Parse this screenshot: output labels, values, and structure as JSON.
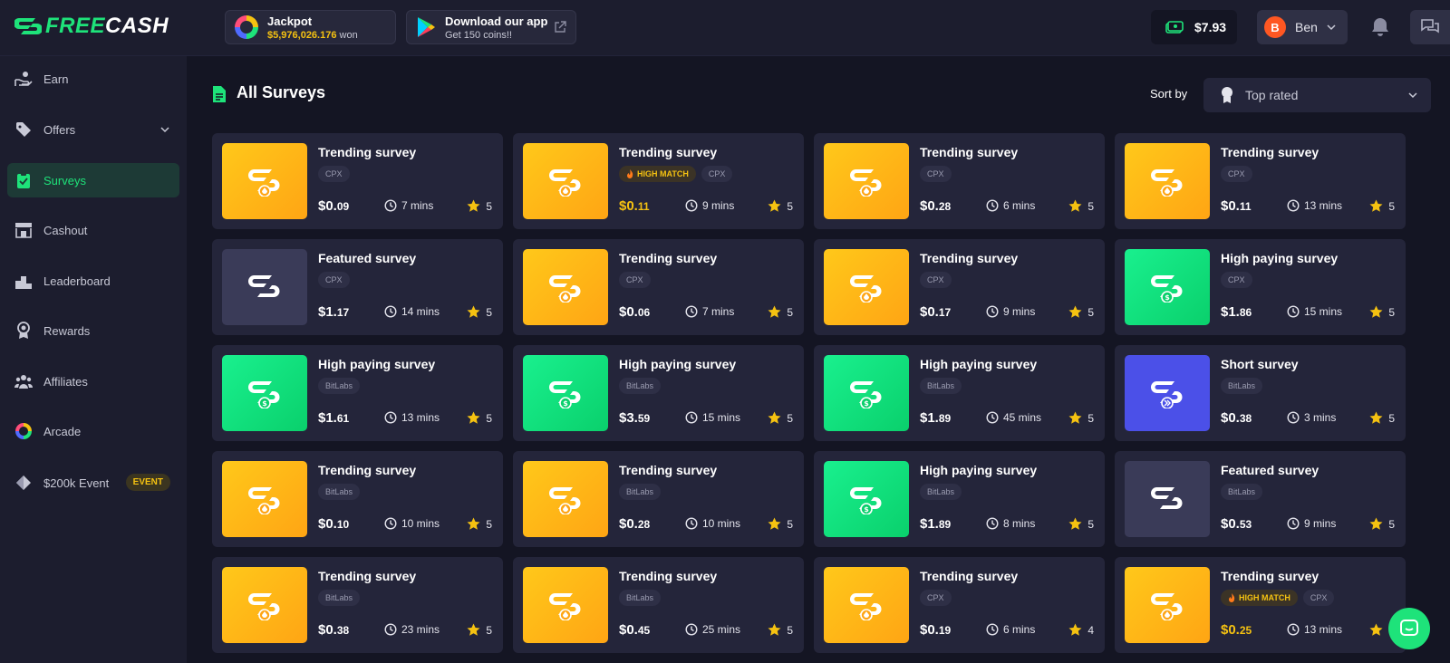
{
  "header": {
    "logo_text": "FREECASH",
    "jackpot": {
      "title": "Jackpot",
      "amount": "$5,976,026.176",
      "suffix": "won"
    },
    "download": {
      "title": "Download our app",
      "subtitle": "Get 150 coins!!"
    },
    "balance": "$7.93",
    "user": {
      "initial": "B",
      "name": "Ben"
    }
  },
  "sidebar": {
    "items": [
      {
        "label": "Earn",
        "icon": "hand-coin-icon"
      },
      {
        "label": "Offers",
        "icon": "tag-icon"
      },
      {
        "label": "Surveys",
        "icon": "clipboard-icon"
      },
      {
        "label": "Cashout",
        "icon": "store-icon"
      },
      {
        "label": "Leaderboard",
        "icon": "podium-icon"
      },
      {
        "label": "Rewards",
        "icon": "medal-icon"
      },
      {
        "label": "Affiliates",
        "icon": "users-icon"
      },
      {
        "label": "Arcade",
        "icon": "ring-icon"
      },
      {
        "label": "$200k Event",
        "icon": "diamond-icon",
        "badge": "EVENT"
      }
    ]
  },
  "main": {
    "title": "All Surveys",
    "sort_label": "Sort by",
    "sort_value": "Top rated",
    "surveys": [
      {
        "title": "Trending survey",
        "provider": "CPX",
        "high_match": false,
        "dollars": "$0.",
        "cents": "09",
        "time": "7 mins",
        "rating": "5",
        "style": "orange"
      },
      {
        "title": "Trending survey",
        "provider": "CPX",
        "high_match": true,
        "dollars": "$0.",
        "cents": "11",
        "time": "9 mins",
        "rating": "5",
        "style": "orange"
      },
      {
        "title": "Trending survey",
        "provider": "CPX",
        "high_match": false,
        "dollars": "$0.",
        "cents": "28",
        "time": "6 mins",
        "rating": "5",
        "style": "orange"
      },
      {
        "title": "Trending survey",
        "provider": "CPX",
        "high_match": false,
        "dollars": "$0.",
        "cents": "11",
        "time": "13 mins",
        "rating": "5",
        "style": "orange"
      },
      {
        "title": "Featured survey",
        "provider": "CPX",
        "high_match": false,
        "dollars": "$1.",
        "cents": "17",
        "time": "14 mins",
        "rating": "5",
        "style": "slate"
      },
      {
        "title": "Trending survey",
        "provider": "CPX",
        "high_match": false,
        "dollars": "$0.",
        "cents": "06",
        "time": "7 mins",
        "rating": "5",
        "style": "orange"
      },
      {
        "title": "Trending survey",
        "provider": "CPX",
        "high_match": false,
        "dollars": "$0.",
        "cents": "17",
        "time": "9 mins",
        "rating": "5",
        "style": "orange"
      },
      {
        "title": "High paying survey",
        "provider": "CPX",
        "high_match": false,
        "dollars": "$1.",
        "cents": "86",
        "time": "15 mins",
        "rating": "5",
        "style": "green"
      },
      {
        "title": "High paying survey",
        "provider": "BitLabs",
        "high_match": false,
        "dollars": "$1.",
        "cents": "61",
        "time": "13 mins",
        "rating": "5",
        "style": "green"
      },
      {
        "title": "High paying survey",
        "provider": "BitLabs",
        "high_match": false,
        "dollars": "$3.",
        "cents": "59",
        "time": "15 mins",
        "rating": "5",
        "style": "green"
      },
      {
        "title": "High paying survey",
        "provider": "BitLabs",
        "high_match": false,
        "dollars": "$1.",
        "cents": "89",
        "time": "45 mins",
        "rating": "5",
        "style": "green"
      },
      {
        "title": "Short survey",
        "provider": "BitLabs",
        "high_match": false,
        "dollars": "$0.",
        "cents": "38",
        "time": "3 mins",
        "rating": "5",
        "style": "purple"
      },
      {
        "title": "Trending survey",
        "provider": "BitLabs",
        "high_match": false,
        "dollars": "$0.",
        "cents": "10",
        "time": "10 mins",
        "rating": "5",
        "style": "orange"
      },
      {
        "title": "Trending survey",
        "provider": "BitLabs",
        "high_match": false,
        "dollars": "$0.",
        "cents": "28",
        "time": "10 mins",
        "rating": "5",
        "style": "orange"
      },
      {
        "title": "High paying survey",
        "provider": "BitLabs",
        "high_match": false,
        "dollars": "$1.",
        "cents": "89",
        "time": "8 mins",
        "rating": "5",
        "style": "green"
      },
      {
        "title": "Featured survey",
        "provider": "BitLabs",
        "high_match": false,
        "dollars": "$0.",
        "cents": "53",
        "time": "9 mins",
        "rating": "5",
        "style": "slate"
      },
      {
        "title": "Trending survey",
        "provider": "BitLabs",
        "high_match": false,
        "dollars": "$0.",
        "cents": "38",
        "time": "23 mins",
        "rating": "5",
        "style": "orange"
      },
      {
        "title": "Trending survey",
        "provider": "BitLabs",
        "high_match": false,
        "dollars": "$0.",
        "cents": "45",
        "time": "25 mins",
        "rating": "5",
        "style": "orange"
      },
      {
        "title": "Trending survey",
        "provider": "CPX",
        "high_match": false,
        "dollars": "$0.",
        "cents": "19",
        "time": "6 mins",
        "rating": "4",
        "style": "orange"
      },
      {
        "title": "Trending survey",
        "provider": "CPX",
        "high_match": true,
        "dollars": "$0.",
        "cents": "25",
        "time": "13 mins",
        "rating": "5",
        "style": "orange"
      }
    ],
    "high_match_label": "HIGH MATCH"
  },
  "colors": {
    "accent": "#1ee37a",
    "gold": "#f5c211",
    "bg": "#141523",
    "panel": "#1c1d2e",
    "card": "#24253a"
  }
}
